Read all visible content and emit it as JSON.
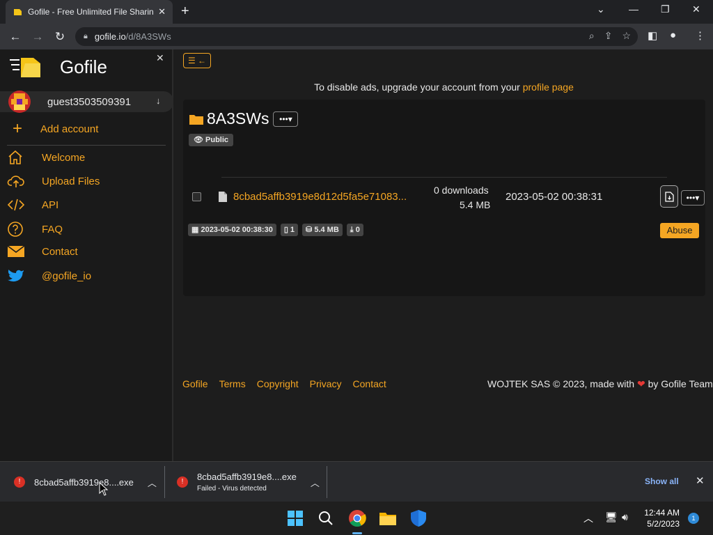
{
  "browser": {
    "tab_title": "Gofile - Free Unlimited File Sharing",
    "tab_close": "✕",
    "new_tab": "+",
    "url_host": "gofile.io",
    "url_path": "/d/8A3SWs"
  },
  "sidebar": {
    "brand": "Gofile",
    "account_name": "guest3503509391",
    "add_account": "Add account",
    "items": [
      {
        "label": "Welcome",
        "icon": "home-icon"
      },
      {
        "label": "Upload Files",
        "icon": "cloud-upload-icon"
      },
      {
        "label": "API",
        "icon": "code-icon"
      },
      {
        "label": "FAQ",
        "icon": "question-icon"
      },
      {
        "label": "Contact",
        "icon": "mail-icon"
      },
      {
        "label": "@gofile_io",
        "icon": "twitter-icon"
      }
    ]
  },
  "main": {
    "ad_text": "To disable ads, upgrade your account from your ",
    "ad_link": "profile page",
    "folder_name": "8A3SWs",
    "folder_visibility": "Public",
    "file": {
      "name": "8cbad5affb3919e8d12d5fa5e71083...",
      "downloads": "0 downloads",
      "size": "5.4 MB",
      "date": "2023-05-02 00:38:31"
    },
    "tags": {
      "date": "2023-05-02 00:38:30",
      "files": "1",
      "size": "5.4 MB",
      "downloads": "0"
    },
    "abuse_label": "Abuse"
  },
  "footer": {
    "links": [
      "Gofile",
      "Terms",
      "Copyright",
      "Privacy",
      "Contact"
    ],
    "credit_pre": "WOJTEK SAS © 2023, made with ",
    "credit_post": " by Gofile Team"
  },
  "downloads": {
    "items": [
      {
        "name": "8cbad5affb3919e8....exe",
        "status": ""
      },
      {
        "name": "8cbad5affb3919e8....exe",
        "status": "Failed - Virus detected"
      }
    ],
    "show_all": "Show all"
  },
  "taskbar": {
    "time": "12:44 AM",
    "date": "5/2/2023",
    "notifications": "1"
  },
  "colors": {
    "accent": "#f5a623",
    "background": "#1d1d1d",
    "link_blue": "#8ab4f8"
  }
}
